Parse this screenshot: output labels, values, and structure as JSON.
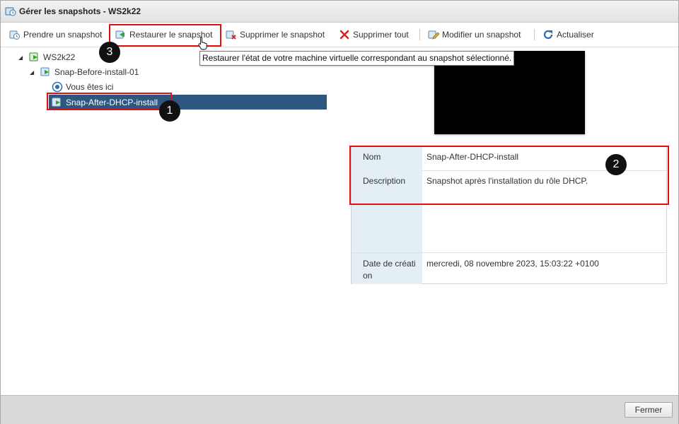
{
  "window": {
    "title": "Gérer les snapshots - WS2k22"
  },
  "toolbar": {
    "take_snapshot": "Prendre un snapshot",
    "restore_snapshot": "Restaurer le snapshot",
    "delete_snapshot": "Supprimer le snapshot",
    "delete_all": "Supprimer tout",
    "edit_snapshot": "Modifier un snapshot",
    "refresh": "Actualiser"
  },
  "tooltip": {
    "text": "Restaurer l'état de votre machine virtuelle correspondant au snapshot sélectionné."
  },
  "tree": {
    "root": "WS2k22",
    "snapshot_1": "Snap-Before-install-01",
    "you_are_here": "Vous êtes ici",
    "snapshot_2": "Snap-After-DHCP-install"
  },
  "details": {
    "name_label": "Nom",
    "name_value": "Snap-After-DHCP-install",
    "description_label": "Description",
    "description_value": "Snapshot après l'installation du rôle DHCP.",
    "date_label": "Date de création",
    "date_value": "mercredi, 08 novembre 2023, 15:03:22 +0100"
  },
  "annotations": {
    "badge_1": "1",
    "badge_2": "2",
    "badge_3": "3"
  },
  "footer": {
    "close_label": "Fermer"
  },
  "colors": {
    "selection": "#2d5780",
    "annotation_red": "#e01010",
    "key_cell_bg": "#e4eef5"
  }
}
